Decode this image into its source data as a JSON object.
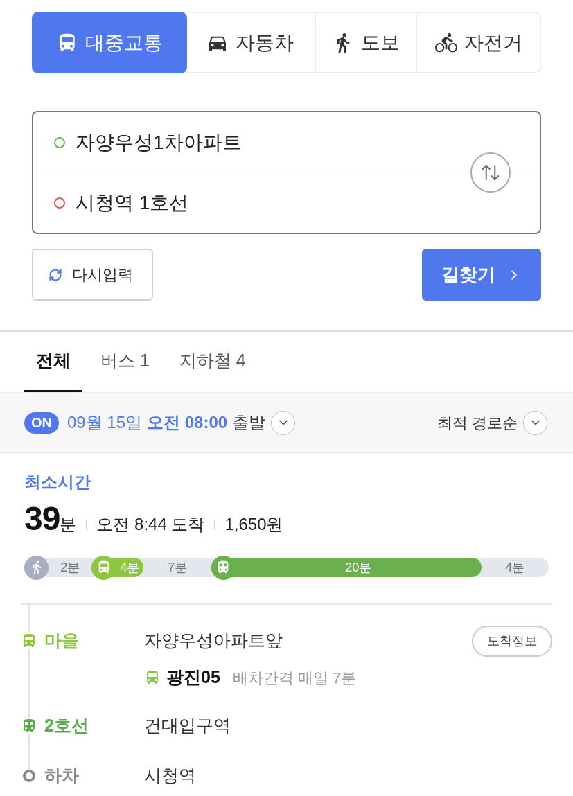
{
  "modes": [
    {
      "kind": "transit",
      "label": "대중교통",
      "selected": true
    },
    {
      "kind": "car",
      "label": "자동차",
      "selected": false
    },
    {
      "kind": "walk",
      "label": "도보",
      "selected": false
    },
    {
      "kind": "bike",
      "label": "자전거",
      "selected": false
    }
  ],
  "route_inputs": [
    {
      "value": "자양우성1차아파트",
      "color": "#6cb85a"
    },
    {
      "value": "시청역 1호선",
      "color": "#d05c5c"
    }
  ],
  "actions": {
    "reset": "다시입력",
    "search": "길찾기"
  },
  "result_tabs": [
    {
      "label": "전체",
      "selected": true
    },
    {
      "label": "버스 1",
      "selected": false
    },
    {
      "label": "지하철 4",
      "selected": false
    }
  ],
  "departure": {
    "badge": "ON",
    "date": "09월 15일",
    "time": "오전 08:00",
    "suffix": "출발",
    "sort": "최적 경로순"
  },
  "summary": {
    "label": "최소시간",
    "duration": "39",
    "duration_unit": "분",
    "arrival": "오전 8:44 도착",
    "fare": "1,650원"
  },
  "segments": [
    {
      "kind": "walk",
      "icon": true,
      "duration": "2분"
    },
    {
      "kind": "bus",
      "icon": true,
      "duration": "4분",
      "color": "#8dc63f"
    },
    {
      "kind": "walk",
      "icon": false,
      "duration": "7분"
    },
    {
      "kind": "subway",
      "icon": true,
      "duration": "20분",
      "color": "#6ab04c"
    },
    {
      "kind": "walk",
      "icon": false,
      "duration": "4분"
    }
  ],
  "steps": [
    {
      "kind": "bus",
      "label": "마을",
      "color": "#8dc63f",
      "stop": "자양우성아파트앞",
      "action": "도착정보",
      "route": {
        "number": "광진05",
        "interval": "배차간격 매일 7분"
      }
    },
    {
      "kind": "subway",
      "label": "2호선",
      "color": "#5aad4a",
      "stop": "건대입구역"
    },
    {
      "kind": "alight",
      "label": "하차",
      "color": "#888888",
      "stop": "시청역"
    }
  ]
}
